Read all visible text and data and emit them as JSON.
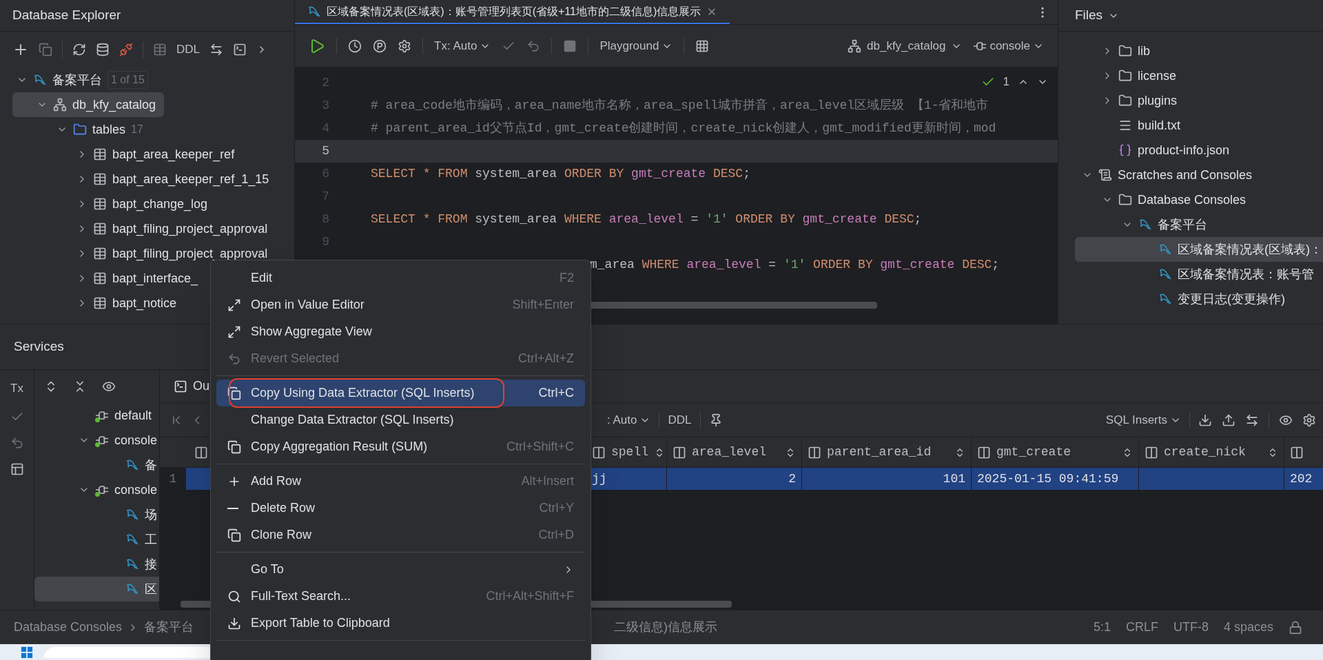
{
  "db_explorer": {
    "title": "Database Explorer",
    "toolbar_text": "DDL",
    "tree": [
      {
        "label": "备案平台",
        "badge": "1 of 15",
        "kind": "datasource",
        "expanded": true,
        "selected": false,
        "children": [
          {
            "label": "db_kfy_catalog",
            "kind": "schema",
            "expanded": true,
            "selected": true,
            "children": [
              {
                "label": "tables",
                "count": "17",
                "kind": "tables",
                "expanded": true,
                "selected": false,
                "children": [
                  {
                    "label": "bapt_area_keeper_ref",
                    "kind": "table",
                    "expanded": false,
                    "selected": false
                  },
                  {
                    "label": "bapt_area_keeper_ref_1_15",
                    "kind": "table",
                    "expanded": false,
                    "selected": false
                  },
                  {
                    "label": "bapt_change_log",
                    "kind": "table",
                    "expanded": false,
                    "selected": false
                  },
                  {
                    "label": "bapt_filing_project_approval",
                    "kind": "table",
                    "expanded": false,
                    "selected": false
                  },
                  {
                    "label": "bapt_filing_project_approval",
                    "kind": "table",
                    "expanded": false,
                    "selected": false
                  },
                  {
                    "label": "bapt_interface_",
                    "kind": "table",
                    "expanded": false,
                    "selected": false
                  },
                  {
                    "label": "bapt_notice",
                    "kind": "table",
                    "expanded": false,
                    "selected": false
                  }
                ]
              }
            ]
          }
        ]
      }
    ]
  },
  "editor": {
    "tab": {
      "title": "区域备案情况表(区域表)：账号管理列表页(省级+11地市的二级信息)信息展示",
      "selected": true
    },
    "toolbar": {
      "tx": "Tx: Auto",
      "mode": "Playground",
      "schema": "db_kfy_catalog",
      "session": "console"
    },
    "inspections": "1",
    "lines": [
      {
        "number": "2",
        "current": false
      },
      {
        "number": "3",
        "current": false,
        "tokens": [
          {
            "kind": "comment",
            "text": "# area_code地市编码，area_name地市名称，area_spell城市拼音，area_level区域层级 【1-省和地市"
          }
        ]
      },
      {
        "number": "4",
        "current": false,
        "tokens": [
          {
            "kind": "comment",
            "text": "# parent_area_id父节点Id，gmt_create创建时间，create_nick创建人，gmt_modified更新时间，mod"
          }
        ]
      },
      {
        "number": "5",
        "current": true
      },
      {
        "number": "6",
        "current": false,
        "tokens": [
          {
            "kind": "keyword",
            "text": "SELECT "
          },
          {
            "kind": "keyword",
            "text": "* "
          },
          {
            "kind": "keyword",
            "text": "FROM "
          },
          {
            "kind": "plain",
            "text": "system_area "
          },
          {
            "kind": "keyword",
            "text": "ORDER BY "
          },
          {
            "kind": "column",
            "text": "gmt_create "
          },
          {
            "kind": "keyword",
            "text": "DESC"
          },
          {
            "kind": "plain",
            "text": ";"
          }
        ]
      },
      {
        "number": "7",
        "current": false
      },
      {
        "number": "8",
        "current": false,
        "tokens": [
          {
            "kind": "keyword",
            "text": "SELECT "
          },
          {
            "kind": "keyword",
            "text": "* "
          },
          {
            "kind": "keyword",
            "text": "FROM "
          },
          {
            "kind": "plain",
            "text": "system_area "
          },
          {
            "kind": "keyword",
            "text": "WHERE "
          },
          {
            "kind": "column",
            "text": "area_level "
          },
          {
            "kind": "plain",
            "text": "= "
          },
          {
            "kind": "string",
            "text": "'1' "
          },
          {
            "kind": "keyword",
            "text": "ORDER BY "
          },
          {
            "kind": "column",
            "text": "gmt_create "
          },
          {
            "kind": "keyword",
            "text": "DESC"
          },
          {
            "kind": "plain",
            "text": ";"
          }
        ]
      },
      {
        "number": "9",
        "current": false
      },
      {
        "current": false,
        "tokens": [
          {
            "kind": "plain",
            "text": "m_area "
          },
          {
            "kind": "keyword",
            "text": "WHERE "
          },
          {
            "kind": "column",
            "text": "area_level "
          },
          {
            "kind": "plain",
            "text": "= "
          },
          {
            "kind": "string",
            "text": "'1' "
          },
          {
            "kind": "keyword",
            "text": "ORDER BY "
          },
          {
            "kind": "column",
            "text": "gmt_create "
          },
          {
            "kind": "keyword",
            "text": "DESC"
          },
          {
            "kind": "plain",
            "text": ";"
          }
        ]
      }
    ]
  },
  "files": {
    "title": "Files",
    "tree": [
      {
        "label": "lib",
        "kind": "folder",
        "expanded": false,
        "selected": false
      },
      {
        "label": "license",
        "kind": "folder",
        "expanded": false,
        "selected": false
      },
      {
        "label": "plugins",
        "kind": "folder",
        "expanded": false,
        "selected": false
      },
      {
        "label": "build.txt",
        "kind": "text",
        "selected": false
      },
      {
        "label": "product-info.json",
        "kind": "json",
        "selected": false
      }
    ],
    "scratches": [
      {
        "label": "Scratches and Consoles",
        "kind": "scratches",
        "expanded": true,
        "selected": false,
        "children": [
          {
            "label": "Database Consoles",
            "kind": "folder",
            "expanded": true,
            "selected": false,
            "children": [
              {
                "label": "备案平台",
                "kind": "datasource",
                "expanded": true,
                "selected": false,
                "children": [
                  {
                    "label": "区域备案情况表(区域表)：",
                    "kind": "query",
                    "selected": true
                  },
                  {
                    "label": "区域备案情况表：账号管",
                    "kind": "query",
                    "selected": false
                  },
                  {
                    "label": "变更日志(变更操作)",
                    "kind": "query",
                    "selected": false
                  }
                ]
              }
            ]
          }
        ]
      }
    ]
  },
  "services": {
    "title": "Services",
    "tx": "Tx",
    "tree": [
      {
        "label": "default",
        "kind": "console",
        "selected": false
      },
      {
        "label": "console",
        "kind": "console",
        "expanded": true,
        "selected": false,
        "children": [
          {
            "label": "备",
            "kind": "query",
            "selected": false
          }
        ]
      },
      {
        "label": "console",
        "kind": "console",
        "expanded": true,
        "selected": false,
        "children": [
          {
            "label": "场",
            "kind": "query",
            "selected": false
          },
          {
            "label": "工",
            "kind": "query",
            "selected": false
          },
          {
            "label": "接",
            "kind": "query",
            "selected": false
          },
          {
            "label": "区",
            "kind": "query",
            "selected": true
          }
        ]
      }
    ],
    "output_tab": "Ou",
    "results": {
      "tx": ": Auto",
      "ddl": "DDL",
      "extractor": "SQL Inserts",
      "columns": [
        "spell",
        "area_level",
        "parent_area_id",
        "gmt_create",
        "create_nick"
      ],
      "rows": [
        {
          "number": "1",
          "selected": true,
          "cells": [
            "jj",
            "2",
            "101",
            "2025-01-15 09:41:59",
            null,
            "202"
          ]
        }
      ]
    }
  },
  "context_menu": {
    "groups": [
      [
        {
          "label": "Edit",
          "shortcut": "F2",
          "disabled": false,
          "selected": false
        },
        {
          "label": "Open in Value Editor",
          "shortcut": "Shift+Enter",
          "disabled": false,
          "selected": false
        },
        {
          "label": "Show Aggregate View",
          "disabled": false,
          "selected": false
        },
        {
          "label": "Revert Selected",
          "shortcut": "Ctrl+Alt+Z",
          "disabled": true,
          "selected": false
        }
      ],
      [
        {
          "label": "Copy Using Data Extractor (SQL Inserts)",
          "shortcut": "Ctrl+C",
          "disabled": false,
          "selected": true,
          "outlined": true
        },
        {
          "label": "Change Data Extractor (SQL Inserts)",
          "disabled": false,
          "selected": false
        },
        {
          "label": "Copy Aggregation Result (SUM)",
          "shortcut": "Ctrl+Shift+C",
          "disabled": false,
          "selected": false
        }
      ],
      [
        {
          "label": "Add Row",
          "shortcut": "Alt+Insert",
          "disabled": false,
          "selected": false
        },
        {
          "label": "Delete Row",
          "shortcut": "Ctrl+Y",
          "disabled": false,
          "selected": false
        },
        {
          "label": "Clone Row",
          "shortcut": "Ctrl+D",
          "disabled": false,
          "selected": false
        }
      ],
      [
        {
          "label": "Go To",
          "submenu": true,
          "disabled": false,
          "selected": false
        },
        {
          "label": "Full-Text Search...",
          "shortcut": "Ctrl+Alt+Shift+F",
          "disabled": false,
          "selected": false
        },
        {
          "label": "Export Table to Clipboard",
          "disabled": false,
          "selected": false
        }
      ]
    ]
  },
  "status_bar": {
    "breadcrumbs": [
      "Database Consoles",
      "备案平台"
    ],
    "tail": "二级信息)信息展示",
    "items": [
      "5:1",
      "CRLF",
      "UTF-8",
      "4 spaces"
    ]
  }
}
